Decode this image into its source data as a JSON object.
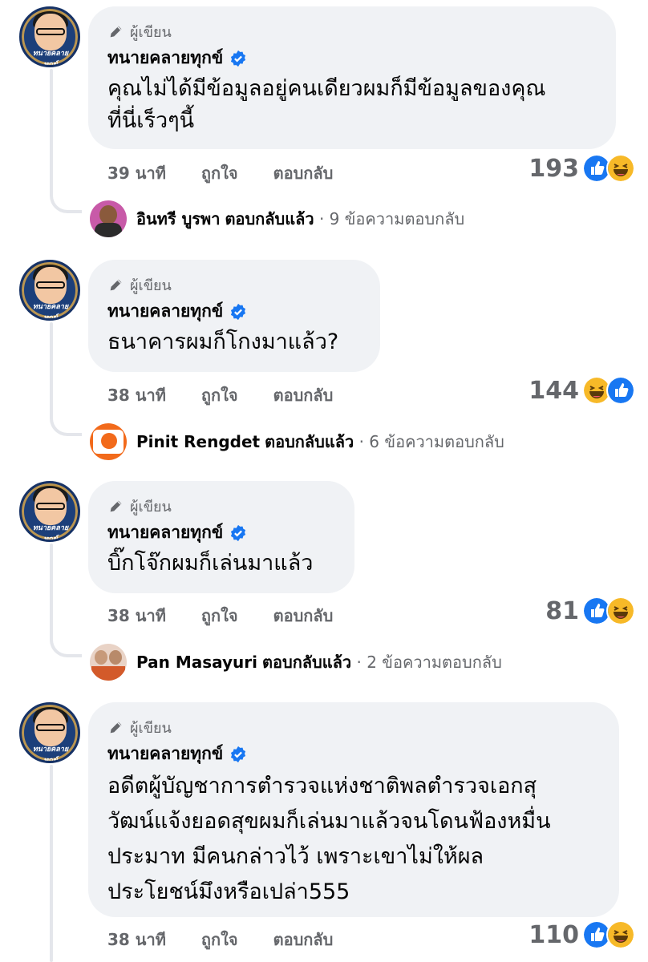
{
  "comments": [
    {
      "badge": "ผู้เขียน",
      "name": "ทนายคลายทุกข์",
      "text_lines": [
        "คุณไม่ได้มีข้อมูลอยู่คนเดียวผมก็มีข้อมูลของคุณ",
        "ที่นี่เร็วๆนี้"
      ],
      "time": "39 นาที",
      "like_label": "ถูกใจ",
      "reply_label": "ตอบกลับ",
      "reaction_count": "193",
      "reactions": [
        "like",
        "haha"
      ],
      "reply": {
        "name": "อินทรี บูรพา",
        "replied_label": "ตอบกลับแล้ว",
        "count_text": "· 9 ข้อความตอบกลับ"
      }
    },
    {
      "badge": "ผู้เขียน",
      "name": "ทนายคลายทุกข์",
      "text_lines": [
        "ธนาคารผมก็โกงมาแล้ว?"
      ],
      "time": "38 นาที",
      "like_label": "ถูกใจ",
      "reply_label": "ตอบกลับ",
      "reaction_count": "144",
      "reactions": [
        "haha",
        "like"
      ],
      "reply": {
        "name": "Pinit Rengdet",
        "replied_label": "ตอบกลับแล้ว",
        "count_text": "· 6 ข้อความตอบกลับ"
      }
    },
    {
      "badge": "ผู้เขียน",
      "name": "ทนายคลายทุกข์",
      "text_lines": [
        "บิ๊กโจ๊กผมก็เล่นมาแล้ว"
      ],
      "time": "38 นาที",
      "like_label": "ถูกใจ",
      "reply_label": "ตอบกลับ",
      "reaction_count": "81",
      "reactions": [
        "like",
        "haha"
      ],
      "reply": {
        "name": "Pan Masayuri",
        "replied_label": "ตอบกลับแล้ว",
        "count_text": "· 2 ข้อความตอบกลับ"
      }
    },
    {
      "badge": "ผู้เขียน",
      "name": "ทนายคลายทุกข์",
      "text_lines": [
        "อดีตผู้บัญชาการตำรวจแห่งชาติพลตำรวจเอกสุ",
        "วัฒน์แจ้งยอดสุขผมก็เล่นมาแล้วจนโดนฟ้องหมื่น",
        "ประมาท มีคนกล่าวไว้ เพราะเขาไม่ให้ผล",
        "ประโยชน์มึงหรือเปล่า555"
      ],
      "time": "38 นาที",
      "like_label": "ถูกใจ",
      "reply_label": "ตอบกลับ",
      "reaction_count": "110",
      "reactions": [
        "like",
        "haha"
      ]
    }
  ],
  "avatar_brand": "ทนายคลายทุกข์",
  "colors": {
    "like_blue": "#1877f2",
    "haha_yellow": "#f7b928",
    "bubble_bg": "#f0f2f5",
    "meta_gray": "#65676b",
    "verified_blue": "#1877f2"
  },
  "icons": [
    "pencil-icon",
    "verified-icon",
    "like-reaction-icon",
    "haha-reaction-icon"
  ]
}
